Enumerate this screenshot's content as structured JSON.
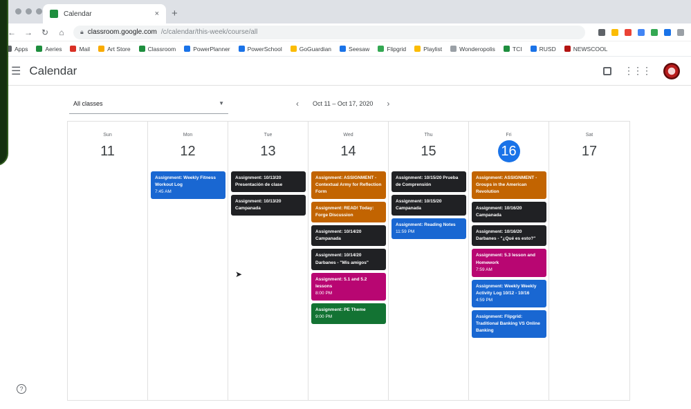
{
  "browser": {
    "tab_title": "Calendar",
    "tab_close": "×",
    "new_tab": "+",
    "url_host": "classroom.google.com",
    "url_path": "/c/calendar/this-week/course/all",
    "bookmarks": [
      "Apps",
      "Aeries",
      "Mail",
      "Art Store",
      "Classroom",
      "PowerPlanner",
      "PowerSchool",
      "GoGuardian",
      "Seesaw",
      "Flipgrid",
      "Playlist",
      "Wonderopolis",
      "TCI",
      "RUSD",
      "NEWSCOOL"
    ]
  },
  "app": {
    "title": "Calendar"
  },
  "controls": {
    "class_filter": "All classes",
    "week_range": "Oct 11 – Oct 17, 2020",
    "prev": "‹",
    "next": "›"
  },
  "days": [
    {
      "dow": "Sun",
      "num": "11",
      "today": false,
      "events": []
    },
    {
      "dow": "Mon",
      "num": "12",
      "today": false,
      "events": [
        {
          "title": "Assignment: Weekly Fitness Workout Log",
          "time": "7:45 AM",
          "color": "blue"
        }
      ]
    },
    {
      "dow": "Tue",
      "num": "13",
      "today": false,
      "events": [
        {
          "title": "Assignment: 10/13/20 Presentación de clase",
          "time": "",
          "color": "black"
        },
        {
          "title": "Assignment: 10/13/20 Campanada",
          "time": "",
          "color": "black"
        }
      ]
    },
    {
      "dow": "Wed",
      "num": "14",
      "today": false,
      "events": [
        {
          "title": "Assignment: ASSIGNMENT - Contextual Army for Reflection Form",
          "time": "",
          "color": "orange"
        },
        {
          "title": "Assignment: READ! Today: Forge Discussion",
          "time": "",
          "color": "orange"
        },
        {
          "title": "Assignment: 10/14/20 Campanada",
          "time": "",
          "color": "black"
        },
        {
          "title": "Assignment: 10/14/20 Darbanes - \"Mis amigos\"",
          "time": "",
          "color": "black"
        },
        {
          "title": "Assignment: 5.1 and 5.2 lessons",
          "time": "8:00 PM",
          "color": "pink"
        },
        {
          "title": "Assignment: PE Theme",
          "time": "9:00 PM",
          "color": "green"
        }
      ]
    },
    {
      "dow": "Thu",
      "num": "15",
      "today": false,
      "events": [
        {
          "title": "Assignment: 10/15/20 Prueba de Comprensión",
          "time": "",
          "color": "black"
        },
        {
          "title": "Assignment: 10/15/20 Campanada",
          "time": "",
          "color": "black"
        },
        {
          "title": "Assignment: Reading Notes",
          "time": "11:59 PM",
          "color": "blue"
        }
      ]
    },
    {
      "dow": "Fri",
      "num": "16",
      "today": true,
      "events": [
        {
          "title": "Assignment: ASSIGNMENT - Groups in the American Revolution",
          "time": "",
          "color": "orange"
        },
        {
          "title": "Assignment: 10/16/20 Campanada",
          "time": "",
          "color": "black"
        },
        {
          "title": "Assignment: 10/16/20 Darbanes - \"¿Qué es esto?\"",
          "time": "",
          "color": "black"
        },
        {
          "title": "Assignment: 5.3 lesson and Homework",
          "time": "7:59 AM",
          "color": "pink"
        },
        {
          "title": "Assignment: Weekly Weekly Activity Log 10/12 - 10/16",
          "time": "4:59 PM",
          "color": "blue"
        },
        {
          "title": "Assignment: Flipgrid: Traditional Banking VS Online Banking",
          "time": "",
          "color": "blue"
        }
      ]
    },
    {
      "dow": "Sat",
      "num": "17",
      "today": false,
      "events": []
    }
  ],
  "colors": {
    "blue": "#1967d2",
    "black": "#202124",
    "orange": "#c26401",
    "pink": "#b80672",
    "green": "#137333",
    "today": "#1a73e8"
  },
  "help_label": "?"
}
